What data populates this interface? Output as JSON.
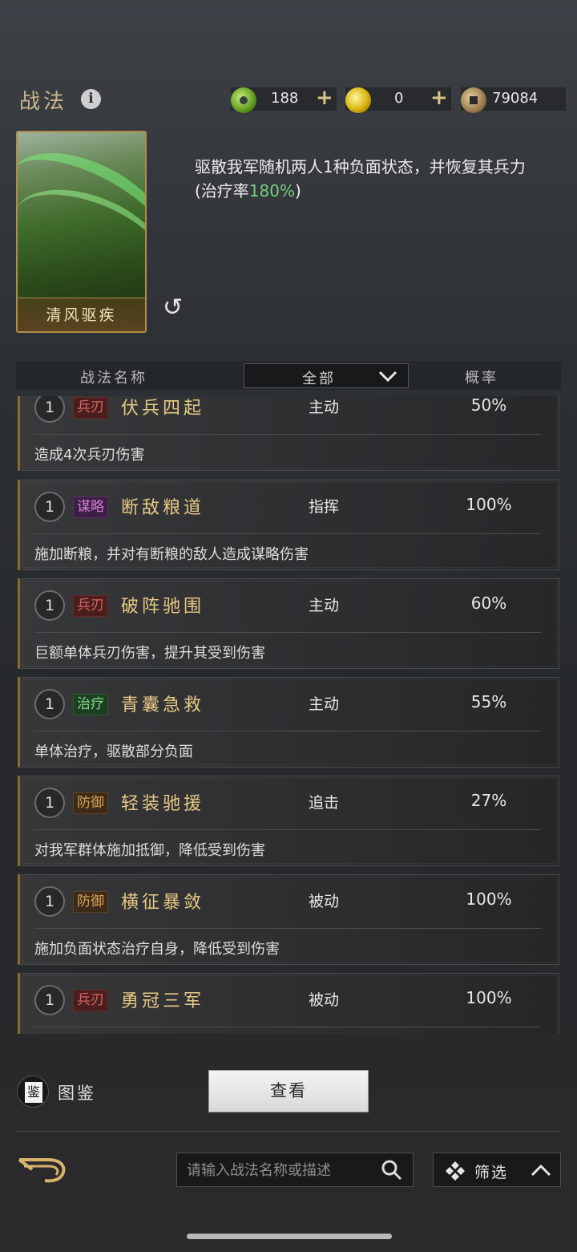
{
  "header": {
    "title": "战法",
    "info_icon": "i",
    "resources": [
      {
        "icon": "jade-coin-icon",
        "value": "188",
        "plus": "+"
      },
      {
        "icon": "gold-coin-icon",
        "value": "0",
        "plus": "+"
      },
      {
        "icon": "copper-coin-icon",
        "value": "79084"
      }
    ]
  },
  "selected_skill": {
    "name": "清风驱疾",
    "description_pre": "驱散我军随机两人1种负面状态，并恢复其兵力(治疗率",
    "description_highlight": "180%",
    "description_post": ")",
    "highlight_color": "#74d07d"
  },
  "table": {
    "col_name": "战法名称",
    "filter_value": "全部",
    "col_rate": "概率"
  },
  "skills": [
    {
      "level": "1",
      "tag": "兵刃",
      "tag_kind": "bing",
      "name": "伏兵四起",
      "type": "主动",
      "rate": "50%",
      "desc": "造成4次兵刃伤害"
    },
    {
      "level": "1",
      "tag": "谋略",
      "tag_kind": "moulue",
      "name": "断敌粮道",
      "type": "指挥",
      "rate": "100%",
      "desc": "施加断粮，并对有断粮的敌人造成谋略伤害"
    },
    {
      "level": "1",
      "tag": "兵刃",
      "tag_kind": "bing",
      "name": "破阵驰围",
      "type": "主动",
      "rate": "60%",
      "desc": "巨额单体兵刃伤害，提升其受到伤害"
    },
    {
      "level": "1",
      "tag": "治疗",
      "tag_kind": "zhiliao",
      "name": "青囊急救",
      "type": "主动",
      "rate": "55%",
      "desc": "单体治疗，驱散部分负面"
    },
    {
      "level": "1",
      "tag": "防御",
      "tag_kind": "fangyu",
      "name": "轻装驰援",
      "type": "追击",
      "rate": "27%",
      "desc": "对我军群体施加抵御，降低受到伤害"
    },
    {
      "level": "1",
      "tag": "防御",
      "tag_kind": "fangyu",
      "name": "横征暴敛",
      "type": "被动",
      "rate": "100%",
      "desc": "施加负面状态治疗自身，降低受到伤害"
    },
    {
      "level": "1",
      "tag": "兵刃",
      "tag_kind": "bing",
      "name": "勇冠三军",
      "type": "被动",
      "rate": "100%",
      "desc": ""
    }
  ],
  "footer": {
    "tujian_icon_char": "鉴",
    "tujian_label": "图鉴",
    "view_button": "查看",
    "search_placeholder": "请输入战法名称或描述",
    "filter_label": "筛选"
  }
}
